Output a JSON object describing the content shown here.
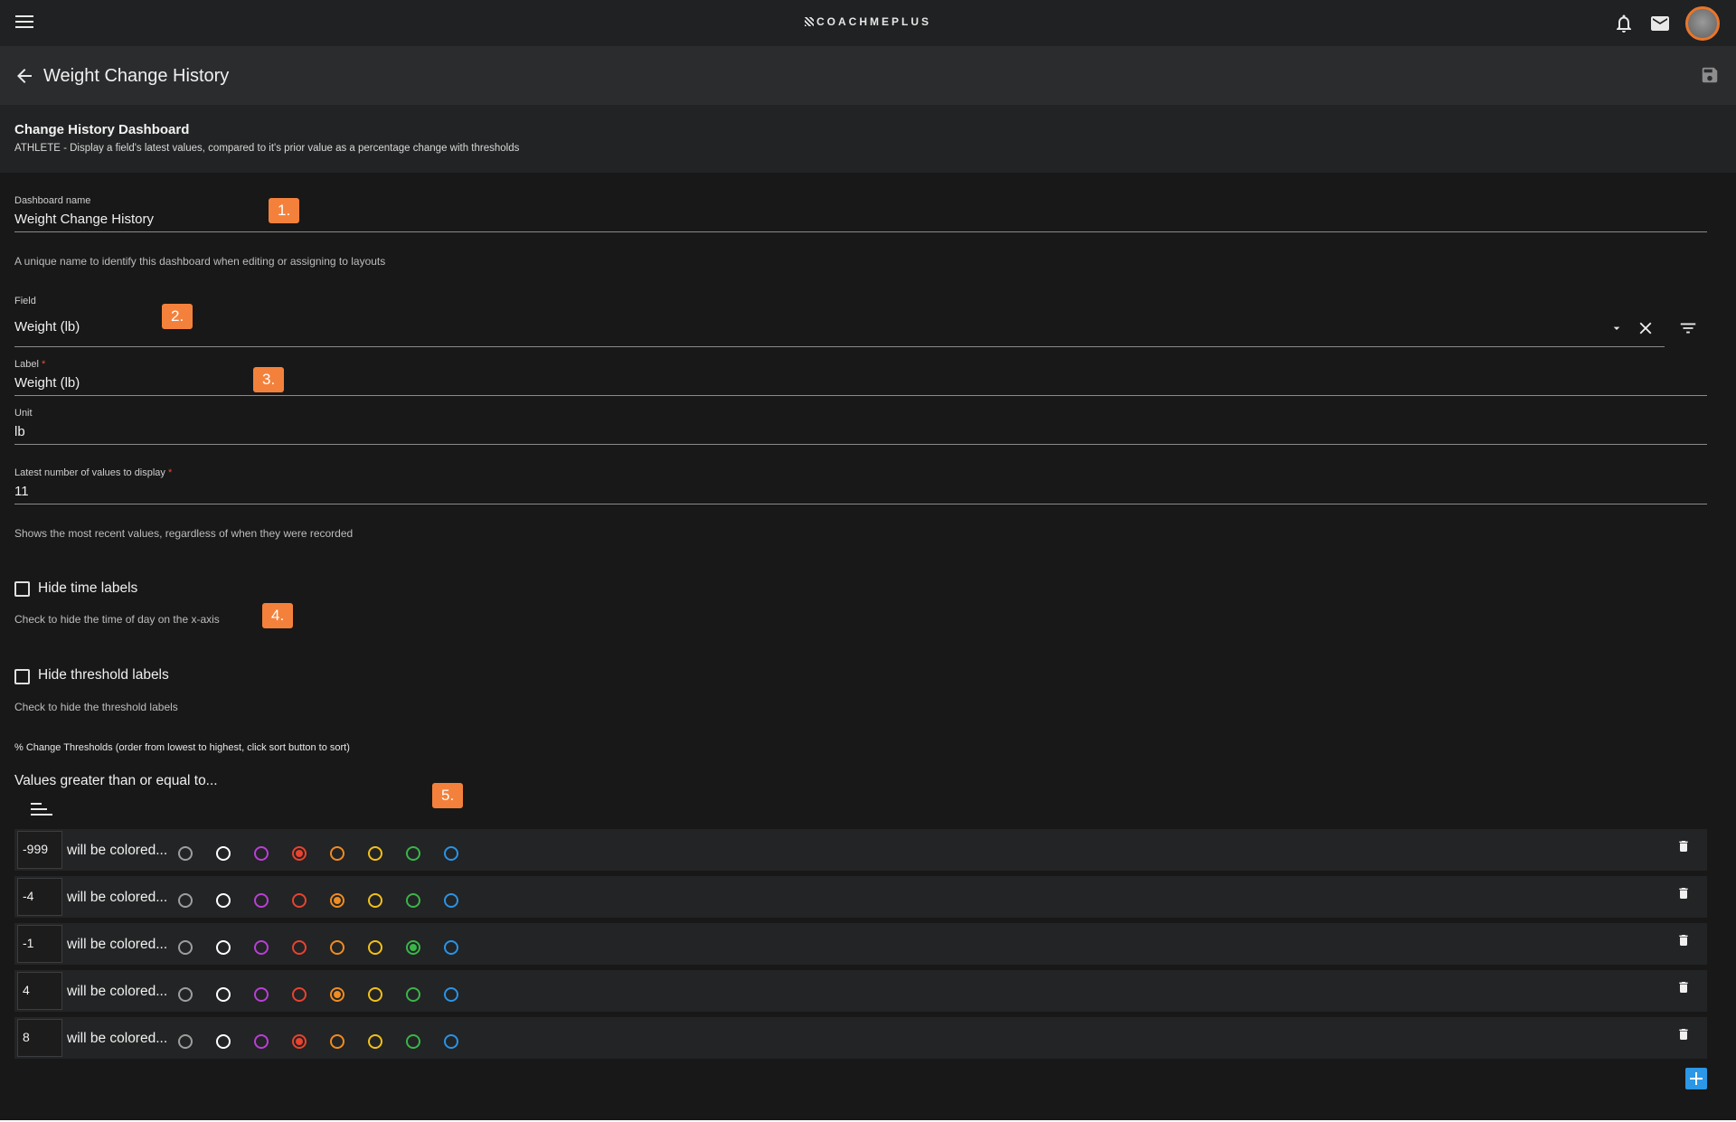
{
  "header": {
    "app_name": "COACHMEPLUS",
    "logo_icon": "coachmeplus-logo"
  },
  "titlebar": {
    "title": "Weight Change History",
    "back_icon": "arrow-left-icon",
    "save_icon": "save-icon"
  },
  "info": {
    "title": "Change History Dashboard",
    "description": "ATHLETE - Display a field's latest values, compared to it's prior value as a percentage change with thresholds"
  },
  "form": {
    "dashboard_name": {
      "label": "Dashboard name",
      "value": "Weight Change History",
      "hint": "A unique name to identify this dashboard when editing or assigning to layouts"
    },
    "field": {
      "label": "Field",
      "value": "Weight (lb)"
    },
    "label": {
      "label": "Label",
      "required_mark": "*",
      "value": "Weight (lb)"
    },
    "unit": {
      "label": "Unit",
      "value": "lb"
    },
    "latest": {
      "label": "Latest number of values to display",
      "required_mark": "*",
      "value": "11",
      "hint": "Shows the most recent values, regardless of when they were recorded"
    },
    "hide_time": {
      "label": "Hide time labels",
      "checked": false,
      "hint": "Check to hide the time of day on the x-axis"
    },
    "hide_threshold": {
      "label": "Hide threshold labels",
      "checked": false,
      "hint": "Check to hide the threshold labels"
    }
  },
  "thresholds": {
    "section_label": "% Change Thresholds (order from lowest to highest, click sort button to sort)",
    "values_title": "Values greater than or equal to...",
    "colored_text": "will be colored...",
    "palette": [
      "#9e9e9e",
      "#ffffff",
      "#b93fd6",
      "#e8432f",
      "#f08c20",
      "#f3c019",
      "#3ab54a",
      "#2a93e6"
    ],
    "rows": [
      {
        "value": "-999",
        "selected": 3
      },
      {
        "value": "-4",
        "selected": 4
      },
      {
        "value": "-1",
        "selected": 6
      },
      {
        "value": "4",
        "selected": 4
      },
      {
        "value": "8",
        "selected": 3
      }
    ]
  },
  "annotations": [
    "1.",
    "2.",
    "3.",
    "4.",
    "5."
  ]
}
